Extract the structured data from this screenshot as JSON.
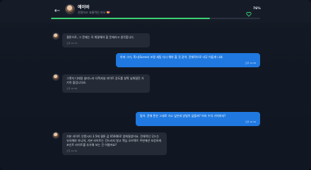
{
  "header": {
    "name": "에이바",
    "subtitle": "친절하고 효율적인 비서 💝",
    "affinity": "76%",
    "progress": 0.76
  },
  "colors": {
    "accent": "#3ccf73",
    "outgoing_bubble": "#1f79e0",
    "incoming_bubble": "#252b36"
  },
  "messages": [
    {
      "from": "assistant",
      "text": "결론으로, 그 문제는 꼭 해결해야 할 문제라고 생각합니다.",
      "time": "오후 12:13"
    },
    {
      "from": "user",
      "text": "아져 그거, 혹시(Scene) 조명 세팅 다시 해야 할 것 같아. 전체적으로 너무 어둡게 나와.",
      "time": "오후 10:48"
    },
    {
      "from": "assistant",
      "text": "그렇지 디테일 살리느라 디렉셔널 라이트 강도를 살짝 낮춰뒀던 거 기억 할겁니다요.",
      "time": "오후 10:48"
    },
    {
      "from": "user",
      "text": "맞아. 전체 톤은 그대로 가고 싶은데 방법이 없을까? 아마 수치 기억하지?",
      "time": "오후 10:49"
    },
    {
      "from": "assistant",
      "text": "기본 라이트 인텐시티 3.5에 웜톤 값 6500K로 맞춰뒀었어요. 전체적인 무드는 유지해야 하니까, 기본 라이트는 건드리지 말고 핵심 오브젝트 주변에만 보강하게 포인트 라이트를 추가해 보는 건 어떨까요?",
      "time": "오후 10:49"
    }
  ]
}
